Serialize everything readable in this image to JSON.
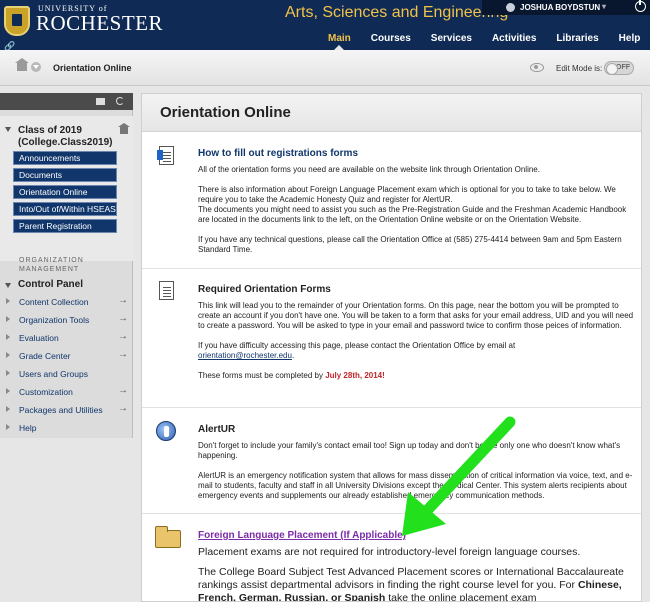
{
  "header": {
    "logo_small": "UNIVERSITY of",
    "logo_name": "ROCHESTER",
    "site_title": "Arts, Sciences and Engineering",
    "user_name": "JOSHUA BOYDSTUN",
    "tabs": [
      {
        "label": "Main",
        "active": true
      },
      {
        "label": "Courses"
      },
      {
        "label": "Services"
      },
      {
        "label": "Activities"
      },
      {
        "label": "Libraries"
      },
      {
        "label": "Help"
      }
    ]
  },
  "breadcrumb": {
    "current": "Orientation Online",
    "edit_mode_label": "Edit Mode is:",
    "edit_mode_state": "OFF"
  },
  "sidebar": {
    "course_title": "Class of 2019 (College.Class2019)",
    "course_links": [
      "Announcements",
      "Documents",
      "Orientation Online",
      "Into/Out of/Within HSEAS",
      "Parent Registration"
    ],
    "org_label_1": "ORGANIZATION",
    "org_label_2": "MANAGEMENT",
    "control_panel": "Control Panel",
    "control_items": [
      {
        "label": "Content Collection",
        "arrow": "→"
      },
      {
        "label": "Organization Tools",
        "arrow": "→"
      },
      {
        "label": "Evaluation",
        "arrow": "→"
      },
      {
        "label": "Grade Center",
        "arrow": "→"
      },
      {
        "label": "Users and Groups",
        "arrow": ""
      },
      {
        "label": "Customization",
        "arrow": "→"
      },
      {
        "label": "Packages and Utilities",
        "arrow": "→"
      },
      {
        "label": "Help",
        "arrow": ""
      }
    ]
  },
  "main": {
    "page_title": "Orientation Online",
    "items": [
      {
        "title": "How to fill out registrations forms",
        "p1": "All of the orientation forms you need are available on the website link through Orientation Online.",
        "p2": "There is also information about Foreign Language Placement exam which is optional for you to take to take below.  We require you to take the Academic Honesty Quiz and register for AlertUR.",
        "p3": "The documents you might need to assist you such as the Pre-Registration Guide and the Freshman Academic Handbook are located in the documents link to the left, on the Orientation Online website or on the Orientation Website.",
        "p4": "If you have any technical questions, please call the Orientation Office at (585) 275-4414 between 9am and 5pm Eastern Standard Time."
      },
      {
        "title": "Required Orientation Forms",
        "p1": "This link will lead you to the remainder of your Orientation forms.  On this page, near the bottom you will be prompted to create an account if you don't have one. You will be taken to a form that asks for your email address, UID and you will need to create a password. You will be asked to type in your email and password twice to confirm those peices of information.",
        "p2": "If you have difficulty accessing this page, please contact the Orientation Office by email at",
        "email": "orientation@rochester.edu",
        "p2_end": ".",
        "p3": "These forms must be completed by",
        "deadline": "July 28th, 2014!"
      },
      {
        "title": "AlertUR",
        "p1": "Don't forget to include your family's contact email too!  Sign up today and don't be the only one who doesn't know what's happening.",
        "p2": "AlertUR is an emergency notification system that allows for mass dissemination of critical information via voice, text, and e-mail to students, faculty and staff in all University Divisions except the Medical Center. This system alerts recipients about emergency events and supplements our already established emergency communication methods."
      },
      {
        "title": "Foreign Language Placement (If Applicable)",
        "p1": "Placement exams are not required for introductory-level foreign language courses.",
        "p2": "The College Board Subject Test Advanced Placement scores or International Baccalaureate rankings assist departmental advisors in finding the right course level for you. For",
        "p2_bold": "Chinese, French, German, Russian, or Spanish",
        "p2_end": "take the online placement exam"
      }
    ]
  },
  "colors": {
    "header_bg": "#0f2a54",
    "accent_gold": "#f1c24a",
    "nav_blue": "#10366b",
    "deadline_red": "#c0252a",
    "arrow_green": "#22e01c"
  }
}
